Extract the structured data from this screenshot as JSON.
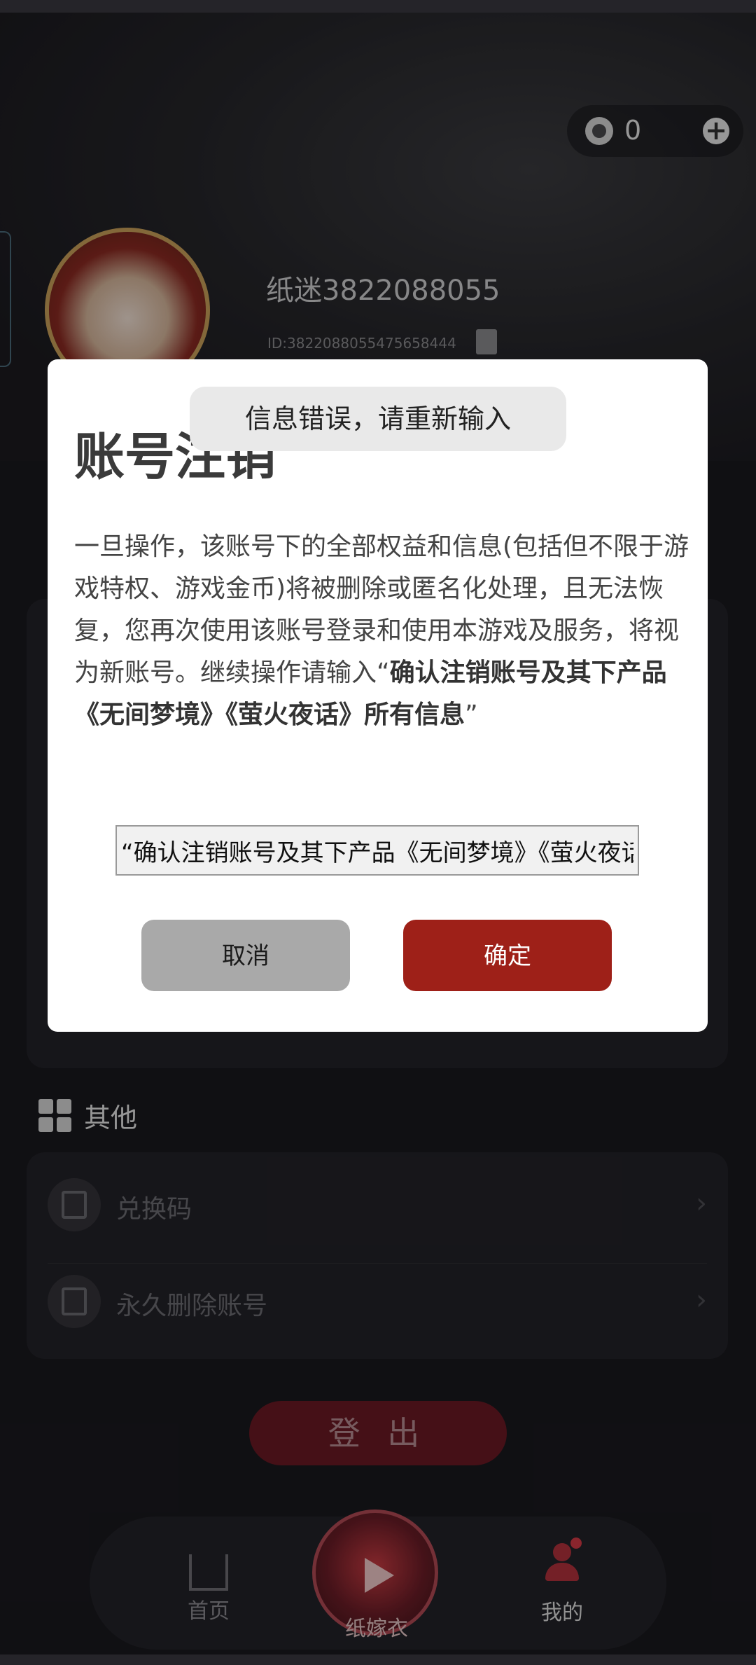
{
  "profile": {
    "coin_count": "0",
    "username": "纸迷3822088055",
    "user_id": "ID:3822088055475658444"
  },
  "other_section": {
    "title": "其他",
    "items": [
      {
        "label": "兑换码",
        "icon": "gift-icon"
      },
      {
        "label": "永久删除账号",
        "icon": "trash-icon"
      }
    ]
  },
  "logout_label": "登 出",
  "nav": {
    "home_label": "首页",
    "center_label": "纸嫁衣",
    "me_label": "我的"
  },
  "dialog": {
    "title": "账号注销",
    "body_plain": "一旦操作，该账号下的全部权益和信息(包括但不限于游戏特权、游戏金币)将被删除或匿名化处理，且无法恢复，您再次使用该账号登录和使用本游戏及服务，将视为新账号。继续操作请输入“",
    "body_bold": "确认注销账号及其下产品《无间梦境》《萤火夜话》所有信息",
    "body_end": "”",
    "input_value": "“确认注销账号及其下产品《无间梦境》《萤火夜话》所有信息”",
    "cancel_label": "取消",
    "confirm_label": "确定"
  },
  "toast": {
    "message": "信息错误，请重新输入"
  },
  "colors": {
    "background": "#1a191e",
    "confirm_button": "#9e2018",
    "cancel_button": "#a9a9a9",
    "accent_red": "#b3323d"
  }
}
